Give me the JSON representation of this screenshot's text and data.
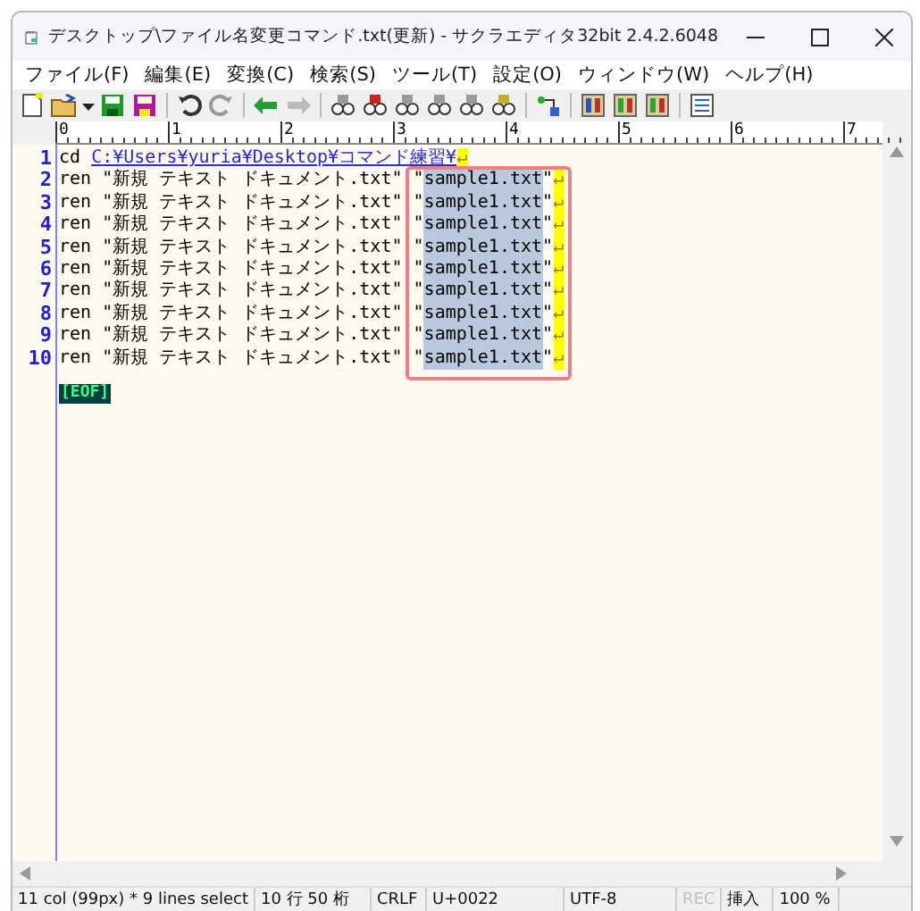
{
  "window": {
    "title": "デスクトップ\\ファイル名変更コマンド.txt(更新) - サクラエディタ32bit 2.4.2.6048"
  },
  "menu": [
    "ファイル(F)",
    "編集(E)",
    "変換(C)",
    "検索(S)",
    "ツール(T)",
    "設定(O)",
    "ウィンドウ(W)",
    "ヘルプ(H)"
  ],
  "ruler": [
    "0",
    "1",
    "2",
    "3",
    "4",
    "5",
    "6",
    "7"
  ],
  "lines": [
    {
      "number": "1",
      "segments": [
        {
          "kind": "text",
          "text": "cd "
        },
        {
          "kind": "link",
          "text": "C:¥Users¥yuria¥Desktop¥コマンド練習¥"
        },
        {
          "kind": "eol",
          "text": "↵"
        }
      ]
    },
    {
      "number": "2",
      "segments": [
        {
          "kind": "text",
          "text": "ren \"新規 テキスト ドキュメント.txt\" \""
        },
        {
          "kind": "selected",
          "text": "sample1.txt"
        },
        {
          "kind": "text",
          "text": "\""
        },
        {
          "kind": "eol",
          "text": "↵"
        }
      ]
    },
    {
      "number": "3",
      "segments": [
        {
          "kind": "text",
          "text": "ren \"新規 テキスト ドキュメント.txt\" \""
        },
        {
          "kind": "selected",
          "text": "sample1.txt"
        },
        {
          "kind": "text",
          "text": "\""
        },
        {
          "kind": "eol",
          "text": "↵"
        }
      ]
    },
    {
      "number": "4",
      "segments": [
        {
          "kind": "text",
          "text": "ren \"新規 テキスト ドキュメント.txt\" \""
        },
        {
          "kind": "selected",
          "text": "sample1.txt"
        },
        {
          "kind": "text",
          "text": "\""
        },
        {
          "kind": "eol",
          "text": "↵"
        }
      ]
    },
    {
      "number": "5",
      "segments": [
        {
          "kind": "text",
          "text": "ren \"新規 テキスト ドキュメント.txt\" \""
        },
        {
          "kind": "selected",
          "text": "sample1.txt"
        },
        {
          "kind": "text",
          "text": "\""
        },
        {
          "kind": "eol",
          "text": "↵"
        }
      ]
    },
    {
      "number": "6",
      "segments": [
        {
          "kind": "text",
          "text": "ren \"新規 テキスト ドキュメント.txt\" \""
        },
        {
          "kind": "selected",
          "text": "sample1.txt"
        },
        {
          "kind": "text",
          "text": "\""
        },
        {
          "kind": "eol",
          "text": "↵"
        }
      ]
    },
    {
      "number": "7",
      "segments": [
        {
          "kind": "text",
          "text": "ren \"新規 テキスト ドキュメント.txt\" \""
        },
        {
          "kind": "selected",
          "text": "sample1.txt"
        },
        {
          "kind": "text",
          "text": "\""
        },
        {
          "kind": "eol",
          "text": "↵"
        }
      ]
    },
    {
      "number": "8",
      "segments": [
        {
          "kind": "text",
          "text": "ren \"新規 テキスト ドキュメント.txt\" \""
        },
        {
          "kind": "selected",
          "text": "sample1.txt"
        },
        {
          "kind": "text",
          "text": "\""
        },
        {
          "kind": "eol",
          "text": "↵"
        }
      ]
    },
    {
      "number": "9",
      "segments": [
        {
          "kind": "text",
          "text": "ren \"新規 テキスト ドキュメント.txt\" \""
        },
        {
          "kind": "selected",
          "text": "sample1.txt"
        },
        {
          "kind": "text",
          "text": "\""
        },
        {
          "kind": "eol",
          "text": "↵"
        }
      ]
    },
    {
      "number": "10",
      "segments": [
        {
          "kind": "text",
          "text": "ren \"新規 テキスト ドキュメント.txt\" \""
        },
        {
          "kind": "selected",
          "text": "sample1.txt"
        },
        {
          "kind": "text",
          "text": "\""
        },
        {
          "kind": "eol",
          "text": "↵"
        }
      ]
    }
  ],
  "eof": "[EOF]",
  "status_bar": [
    {
      "text": "11 col (99px) * 9 lines select",
      "disabled": false
    },
    {
      "text": "10 行  50 桁",
      "disabled": false
    },
    {
      "text": "CRLF",
      "disabled": false
    },
    {
      "text": "U+0022",
      "disabled": false
    },
    {
      "text": "UTF-8",
      "disabled": false
    },
    {
      "text": "REC",
      "disabled": true
    },
    {
      "text": "挿入",
      "disabled": false
    },
    {
      "text": "100 %",
      "disabled": false
    }
  ]
}
